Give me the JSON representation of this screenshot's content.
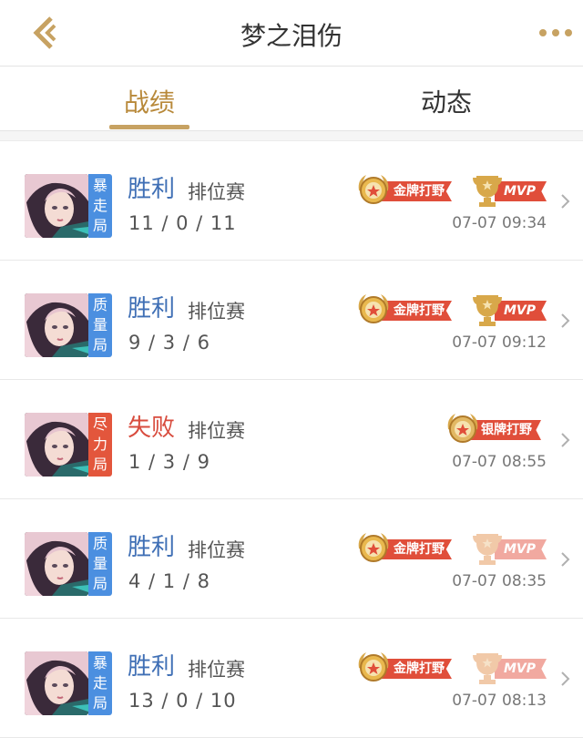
{
  "header": {
    "title": "梦之泪伤",
    "back_icon": "back-arrow-icon",
    "more_icon": "more-dots-icon"
  },
  "tabs": [
    {
      "label": "战绩",
      "active": true
    },
    {
      "label": "动态",
      "active": false
    }
  ],
  "colors": {
    "accent": "#b8893a",
    "win": "#3f6fb5",
    "lose": "#d84c3e",
    "badge_blue": "#4b8fe0",
    "badge_red": "#e3563c",
    "honor_red": "#e04e3a"
  },
  "matches": [
    {
      "result": "胜利",
      "mode": "排位赛",
      "kda": "11 / 0 / 11",
      "time": "07-07 09:34",
      "badge": [
        "暴",
        "走",
        "局"
      ],
      "badge_color": "blue",
      "honor": "金牌打野",
      "mvp": "MVP",
      "mvp_faded": false
    },
    {
      "result": "胜利",
      "mode": "排位赛",
      "kda": "9 / 3 / 6",
      "time": "07-07 09:12",
      "badge": [
        "质",
        "量",
        "局"
      ],
      "badge_color": "blue",
      "honor": "金牌打野",
      "mvp": "MVP",
      "mvp_faded": false
    },
    {
      "result": "失败",
      "mode": "排位赛",
      "kda": "1 / 3 / 9",
      "time": "07-07 08:55",
      "badge": [
        "尽",
        "力",
        "局"
      ],
      "badge_color": "red",
      "honor": "银牌打野",
      "mvp": "",
      "mvp_faded": false
    },
    {
      "result": "胜利",
      "mode": "排位赛",
      "kda": "4 / 1 / 8",
      "time": "07-07 08:35",
      "badge": [
        "质",
        "量",
        "局"
      ],
      "badge_color": "blue",
      "honor": "金牌打野",
      "mvp": "MVP",
      "mvp_faded": true
    },
    {
      "result": "胜利",
      "mode": "排位赛",
      "kda": "13 / 0 / 10",
      "time": "07-07 08:13",
      "badge": [
        "暴",
        "走",
        "局"
      ],
      "badge_color": "blue",
      "honor": "金牌打野",
      "mvp": "MVP",
      "mvp_faded": true
    }
  ]
}
